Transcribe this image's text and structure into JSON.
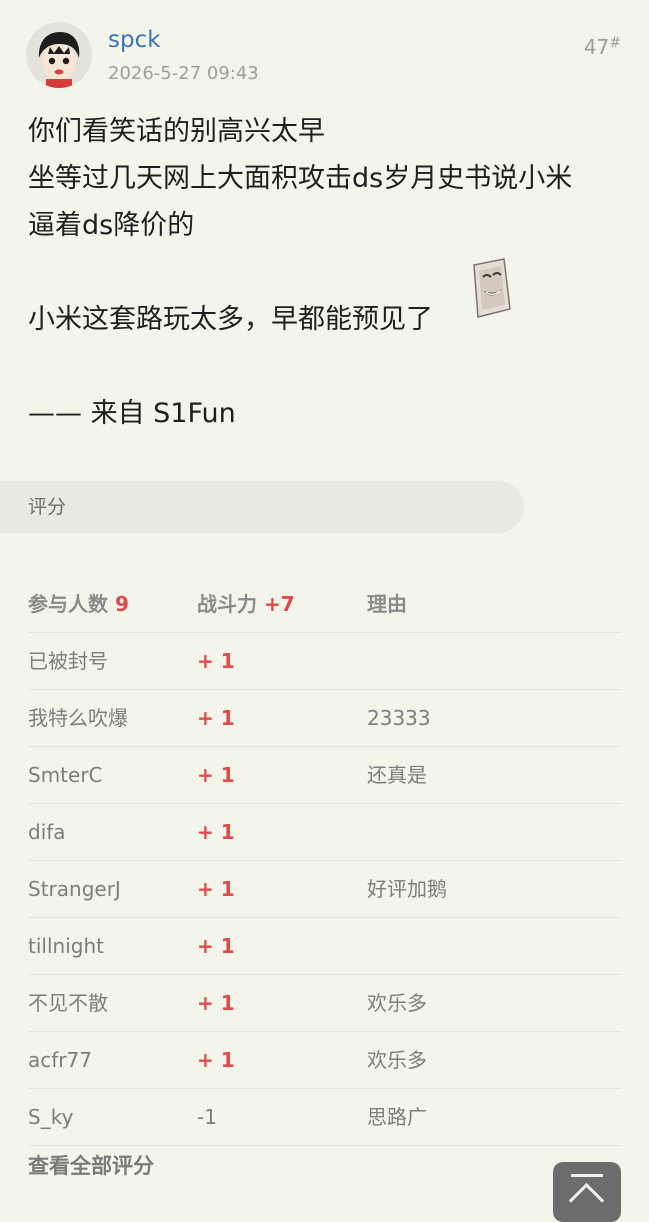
{
  "post": {
    "username": "spck",
    "timestamp": "2026-5-27 09:43",
    "floor": "47",
    "floor_mark": "#",
    "lines": [
      "你们看笑话的别高兴太早",
      "坐等过几天网上大面积攻击ds岁月史书说小米",
      "逼着ds降价的",
      "",
      "小米这套路玩太多，早都能预见了",
      "",
      "—— 来自 S1Fun"
    ]
  },
  "rating": {
    "section_label": "评分",
    "header": {
      "participants_label": "参与人数",
      "participants_count": "9",
      "score_label": "战斗力",
      "score_total": "+7",
      "reason_label": "理由"
    },
    "rows": [
      {
        "user": "已被封号",
        "score": "+ 1",
        "reason": ""
      },
      {
        "user": "我特么吹爆",
        "score": "+ 1",
        "reason": "23333"
      },
      {
        "user": "SmterC",
        "score": "+ 1",
        "reason": "还真是"
      },
      {
        "user": "difa",
        "score": "+ 1",
        "reason": ""
      },
      {
        "user": "StrangerJ",
        "score": "+ 1",
        "reason": "好评加鹅"
      },
      {
        "user": "tillnight",
        "score": "+ 1",
        "reason": ""
      },
      {
        "user": "不见不散",
        "score": "+ 1",
        "reason": "欢乐多"
      },
      {
        "user": "acfr77",
        "score": "+ 1",
        "reason": "欢乐多"
      },
      {
        "user": "S_ky",
        "score": "-1",
        "reason": "思路广"
      }
    ],
    "view_all_label": "查看全部评分"
  },
  "colors": {
    "background": "#f4f5ea",
    "username": "#3b73b8",
    "positive_score": "#e04a4a",
    "muted_text": "#7d7d7d"
  },
  "icons": {
    "avatar": "cartoon-avatar-icon",
    "sticker": "laughing-face-sticker-icon",
    "scroll_top": "scroll-to-top-icon"
  }
}
